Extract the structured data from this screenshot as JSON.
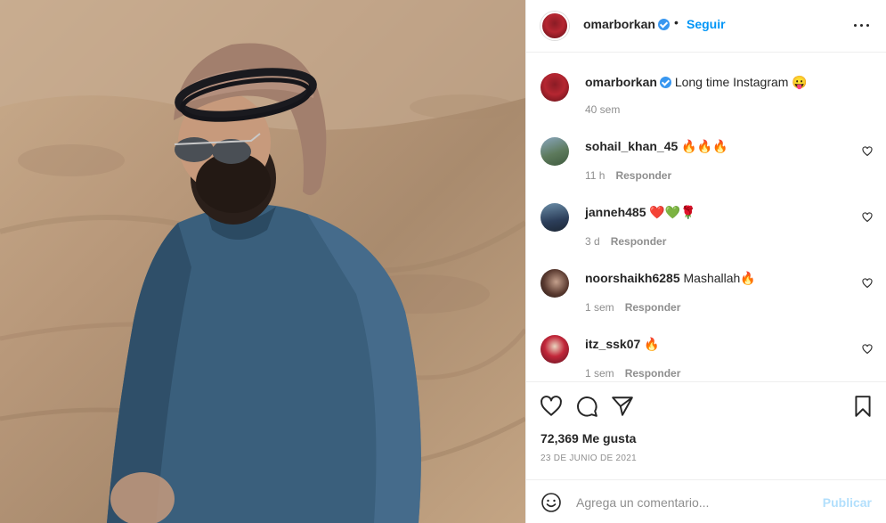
{
  "post": {
    "photo_alt_icon": "photo"
  },
  "header": {
    "username": "omarborkan",
    "separator": "•",
    "follow_label": "Seguir",
    "more_icon": "more-horizontal-icon"
  },
  "caption": {
    "username": "omarborkan",
    "text": "Long time Instagram 😛",
    "time": "40 sem"
  },
  "comments": [
    {
      "username": "sohail_khan_45",
      "text": "🔥🔥🔥",
      "time": "11 h",
      "reply_label": "Responder"
    },
    {
      "username": "janneh485",
      "text": "❤️💚🌹",
      "time": "3 d",
      "reply_label": "Responder"
    },
    {
      "username": "noorshaikh6285",
      "text": "Mashallah🔥",
      "time": "1 sem",
      "reply_label": "Responder"
    },
    {
      "username": "itz_ssk07",
      "text": "🔥",
      "time": "1 sem",
      "reply_label": "Responder"
    }
  ],
  "actions": {
    "likes_label": "72,369 Me gusta",
    "date": "23 DE JUNIO DE 2021"
  },
  "add_comment": {
    "placeholder": "Agrega un comentario...",
    "publish_label": "Publicar"
  },
  "colors": {
    "accent": "#0095f6",
    "publish_disabled": "#b2dffc",
    "verified": "#3897f0",
    "muted": "#8e8e8e"
  }
}
